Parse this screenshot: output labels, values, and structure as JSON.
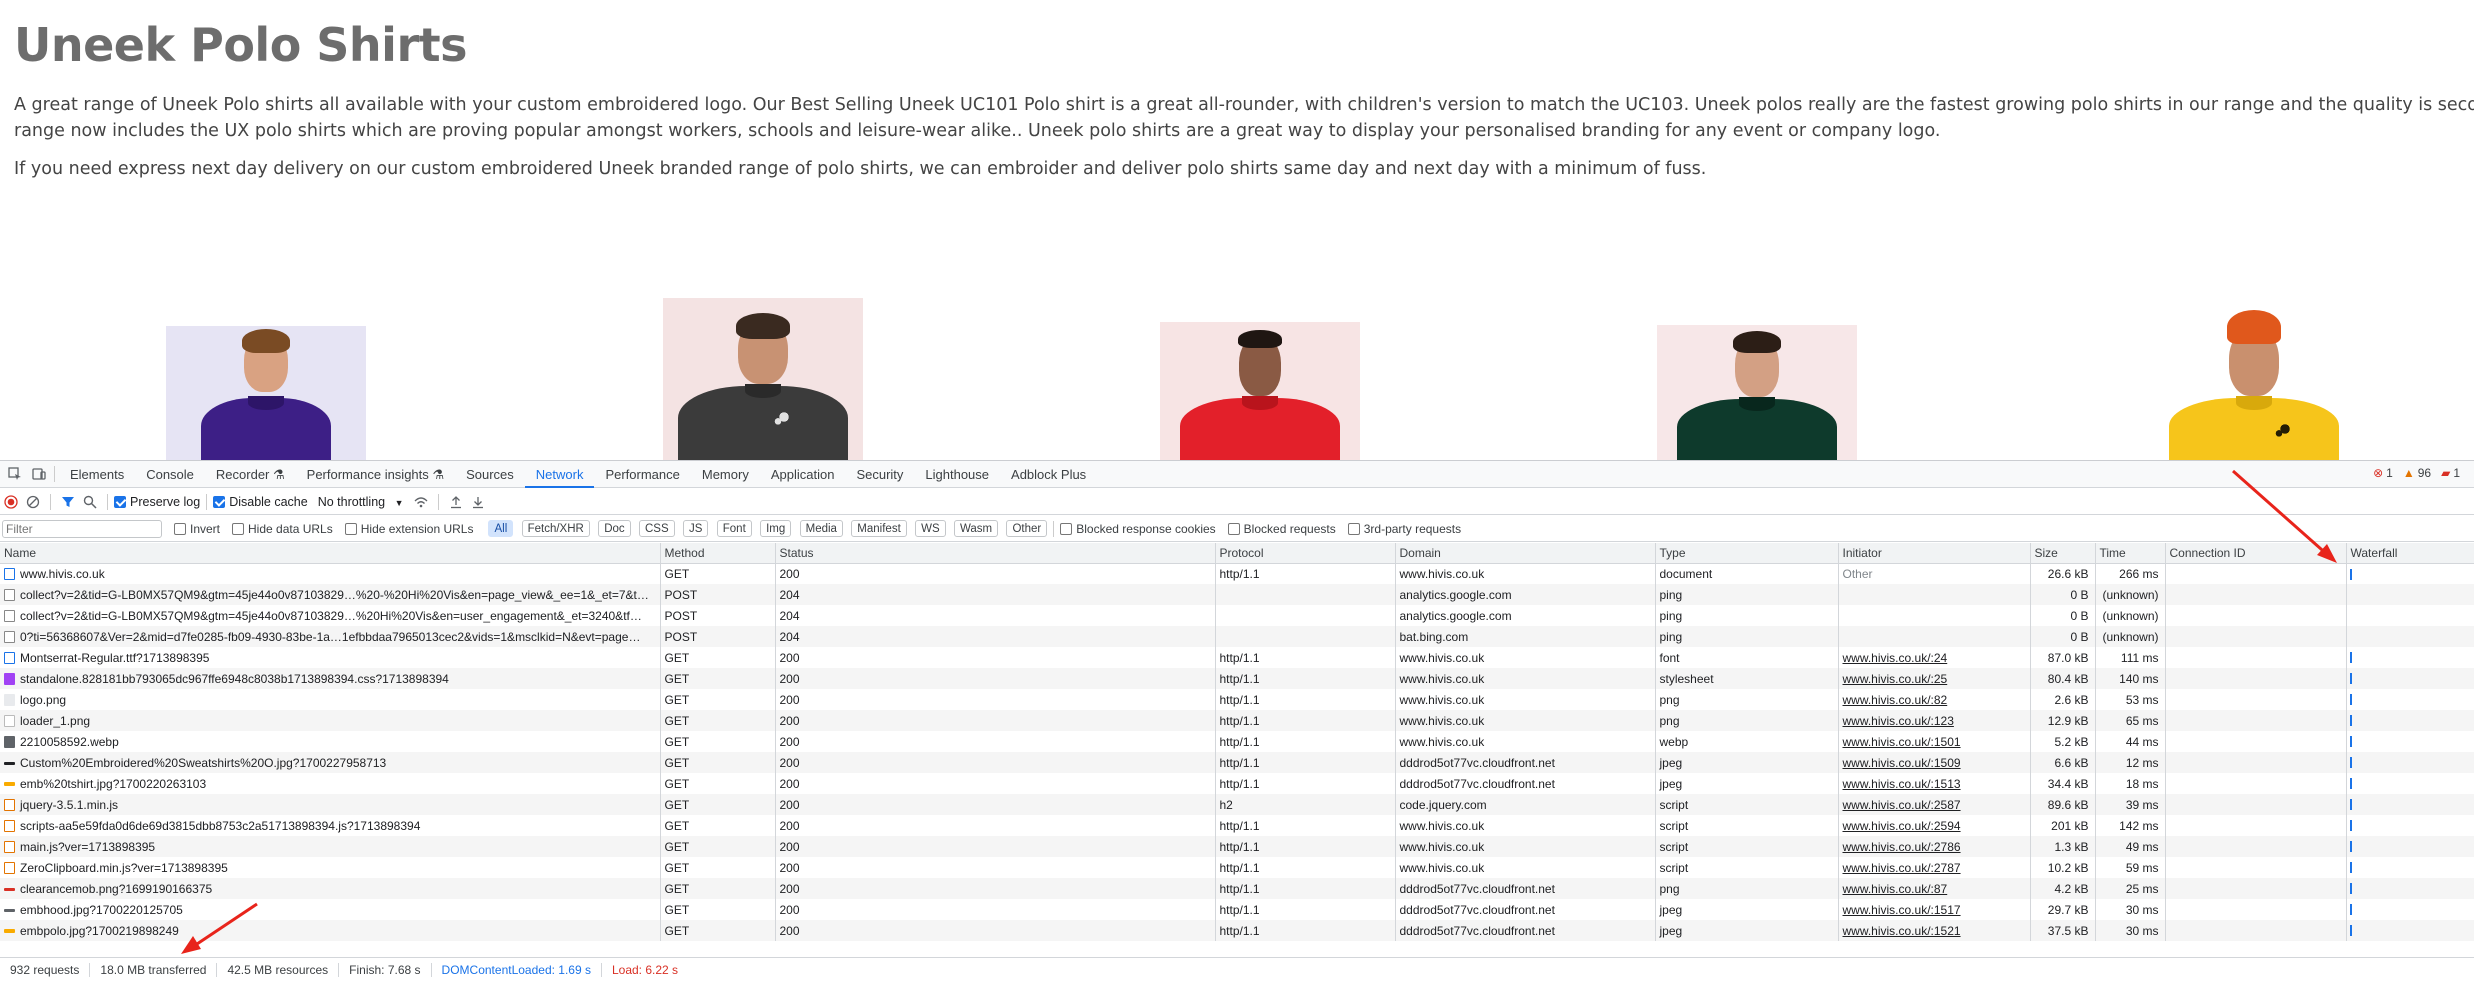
{
  "page": {
    "title": "Uneek Polo Shirts",
    "paragraph1_line1": "A great range of Uneek Polo shirts all available with your custom embroidered logo. Our Best Selling Uneek UC101 Polo shirt is a great all-rounder, with children's version to match the UC103. Uneek polos really are the fastest growing polo shirts in our range and the quality is second to none. Our Uneek",
    "paragraph1_line2": "range now includes the UX polo shirts which are proving popular amongst workers, schools and leisure-wear alike.. Uneek polo shirts are a great way to display your personalised branding for any event or company logo.",
    "paragraph2": "If you need express next day delivery on our custom embroidered Uneek branded range of polo shirts, we can embroider and deliver polo shirts same day and next day with a minimum of fuss."
  },
  "devtools": {
    "tabs": [
      "Elements",
      "Console",
      "Recorder",
      "Performance insights",
      "Sources",
      "Network",
      "Performance",
      "Memory",
      "Application",
      "Security",
      "Lighthouse",
      "Adblock Plus"
    ],
    "active_tab": "Network",
    "issues": {
      "errors": "1",
      "warnings": "96",
      "info": "1"
    },
    "toolbar": {
      "preserve_log": "Preserve log",
      "disable_cache": "Disable cache",
      "throttling": "No throttling"
    },
    "filter": {
      "placeholder": "Filter",
      "invert": "Invert",
      "hide_data_urls": "Hide data URLs",
      "hide_extension_urls": "Hide extension URLs",
      "chips": [
        "All",
        "Fetch/XHR",
        "Doc",
        "CSS",
        "JS",
        "Font",
        "Img",
        "Media",
        "Manifest",
        "WS",
        "Wasm",
        "Other"
      ],
      "blocked_cookies": "Blocked response cookies",
      "blocked_requests": "Blocked requests",
      "third_party": "3rd-party requests"
    },
    "columns": [
      "Name",
      "Method",
      "Status",
      "Protocol",
      "Domain",
      "Type",
      "Initiator",
      "Size",
      "Time",
      "Connection ID",
      "Waterfall"
    ],
    "rows": [
      {
        "name": "www.hivis.co.uk",
        "method": "GET",
        "status": "200",
        "protocol": "http/1.1",
        "domain": "www.hivis.co.uk",
        "type": "document",
        "initiator": "Other",
        "size": "26.6 kB",
        "time": "266 ms",
        "icon": "doc"
      },
      {
        "name": "collect?v=2&tid=G-LB0MX57QM9&gtm=45je44o0v87103829…%20-%20Hi%20Vis&en=page_view&_ee=1&_et=7&t…",
        "method": "POST",
        "status": "204",
        "protocol": "",
        "domain": "analytics.google.com",
        "type": "ping",
        "initiator": "",
        "size": "0 B",
        "time": "(unknown)",
        "icon": "blank"
      },
      {
        "name": "collect?v=2&tid=G-LB0MX57QM9&gtm=45je44o0v87103829…%20Hi%20Vis&en=user_engagement&_et=3240&tf…",
        "method": "POST",
        "status": "204",
        "protocol": "",
        "domain": "analytics.google.com",
        "type": "ping",
        "initiator": "",
        "size": "0 B",
        "time": "(unknown)",
        "icon": "blank"
      },
      {
        "name": "0?ti=56368607&Ver=2&mid=d7fe0285-fb09-4930-83be-1a…1efbbdaa7965013cec2&vids=1&msclkid=N&evt=page…",
        "method": "POST",
        "status": "204",
        "protocol": "",
        "domain": "bat.bing.com",
        "type": "ping",
        "initiator": "",
        "size": "0 B",
        "time": "(unknown)",
        "icon": "blank"
      },
      {
        "name": "Montserrat-Regular.ttf?1713898395",
        "method": "GET",
        "status": "200",
        "protocol": "http/1.1",
        "domain": "www.hivis.co.uk",
        "type": "font",
        "initiator": "www.hivis.co.uk/:24",
        "size": "87.0 kB",
        "time": "111 ms",
        "icon": "font"
      },
      {
        "name": "standalone.828181bb793065dc967ffe6948c8038b1713898394.css?1713898394",
        "method": "GET",
        "status": "200",
        "protocol": "http/1.1",
        "domain": "www.hivis.co.uk",
        "type": "stylesheet",
        "initiator": "www.hivis.co.uk/:25",
        "size": "80.4 kB",
        "time": "140 ms",
        "icon": "css"
      },
      {
        "name": "logo.png",
        "method": "GET",
        "status": "200",
        "protocol": "http/1.1",
        "domain": "www.hivis.co.uk",
        "type": "png",
        "initiator": "www.hivis.co.uk/:82",
        "size": "2.6 kB",
        "time": "53 ms",
        "icon": "img-light"
      },
      {
        "name": "loader_1.png",
        "method": "GET",
        "status": "200",
        "protocol": "http/1.1",
        "domain": "www.hivis.co.uk",
        "type": "png",
        "initiator": "www.hivis.co.uk/:123",
        "size": "12.9 kB",
        "time": "65 ms",
        "icon": "img-dot"
      },
      {
        "name": "2210058592.webp",
        "method": "GET",
        "status": "200",
        "protocol": "http/1.1",
        "domain": "www.hivis.co.uk",
        "type": "webp",
        "initiator": "www.hivis.co.uk/:1501",
        "size": "5.2 kB",
        "time": "44 ms",
        "icon": "img-dark"
      },
      {
        "name": "Custom%20Embroidered%20Sweatshirts%20O.jpg?1700227958713",
        "method": "GET",
        "status": "200",
        "protocol": "http/1.1",
        "domain": "dddrod5ot77vc.cloudfront.net",
        "type": "jpeg",
        "initiator": "www.hivis.co.uk/:1509",
        "size": "6.6 kB",
        "time": "12 ms",
        "icon": "img-black"
      },
      {
        "name": "emb%20tshirt.jpg?1700220263103",
        "method": "GET",
        "status": "200",
        "protocol": "http/1.1",
        "domain": "dddrod5ot77vc.cloudfront.net",
        "type": "jpeg",
        "initiator": "www.hivis.co.uk/:1513",
        "size": "34.4 kB",
        "time": "18 ms",
        "icon": "img-yellow"
      },
      {
        "name": "jquery-3.5.1.min.js",
        "method": "GET",
        "status": "200",
        "protocol": "h2",
        "domain": "code.jquery.com",
        "type": "script",
        "initiator": "www.hivis.co.uk/:2587",
        "size": "89.6 kB",
        "time": "39 ms",
        "icon": "js"
      },
      {
        "name": "scripts-aa5e59fda0d6de69d3815dbb8753c2a51713898394.js?1713898394",
        "method": "GET",
        "status": "200",
        "protocol": "http/1.1",
        "domain": "www.hivis.co.uk",
        "type": "script",
        "initiator": "www.hivis.co.uk/:2594",
        "size": "201 kB",
        "time": "142 ms",
        "icon": "js"
      },
      {
        "name": "main.js?ver=1713898395",
        "method": "GET",
        "status": "200",
        "protocol": "http/1.1",
        "domain": "www.hivis.co.uk",
        "type": "script",
        "initiator": "www.hivis.co.uk/:2786",
        "size": "1.3 kB",
        "time": "49 ms",
        "icon": "js"
      },
      {
        "name": "ZeroClipboard.min.js?ver=1713898395",
        "method": "GET",
        "status": "200",
        "protocol": "http/1.1",
        "domain": "www.hivis.co.uk",
        "type": "script",
        "initiator": "www.hivis.co.uk/:2787",
        "size": "10.2 kB",
        "time": "59 ms",
        "icon": "js"
      },
      {
        "name": "clearancemob.png?1699190166375",
        "method": "GET",
        "status": "200",
        "protocol": "http/1.1",
        "domain": "dddrod5ot77vc.cloudfront.net",
        "type": "png",
        "initiator": "www.hivis.co.uk/:87",
        "size": "4.2 kB",
        "time": "25 ms",
        "icon": "img-red"
      },
      {
        "name": "embhood.jpg?1700220125705",
        "method": "GET",
        "status": "200",
        "protocol": "http/1.1",
        "domain": "dddrod5ot77vc.cloudfront.net",
        "type": "jpeg",
        "initiator": "www.hivis.co.uk/:1517",
        "size": "29.7 kB",
        "time": "30 ms",
        "icon": "img-gray"
      },
      {
        "name": "embpolo.jpg?1700219898249",
        "method": "GET",
        "status": "200",
        "protocol": "http/1.1",
        "domain": "dddrod5ot77vc.cloudfront.net",
        "type": "jpeg",
        "initiator": "www.hivis.co.uk/:1521",
        "size": "37.5 kB",
        "time": "30 ms",
        "icon": "img-yellow"
      }
    ],
    "status": {
      "requests": "932 requests",
      "transferred": "18.0 MB transferred",
      "resources": "42.5 MB resources",
      "finish": "Finish: 7.68 s",
      "dom_content_loaded": "DOMContentLoaded: 1.69 s",
      "load": "Load: 6.22 s"
    }
  },
  "colors": {
    "accent": "#1a73e8",
    "error": "#d93025",
    "arrow": "#e8241b"
  }
}
